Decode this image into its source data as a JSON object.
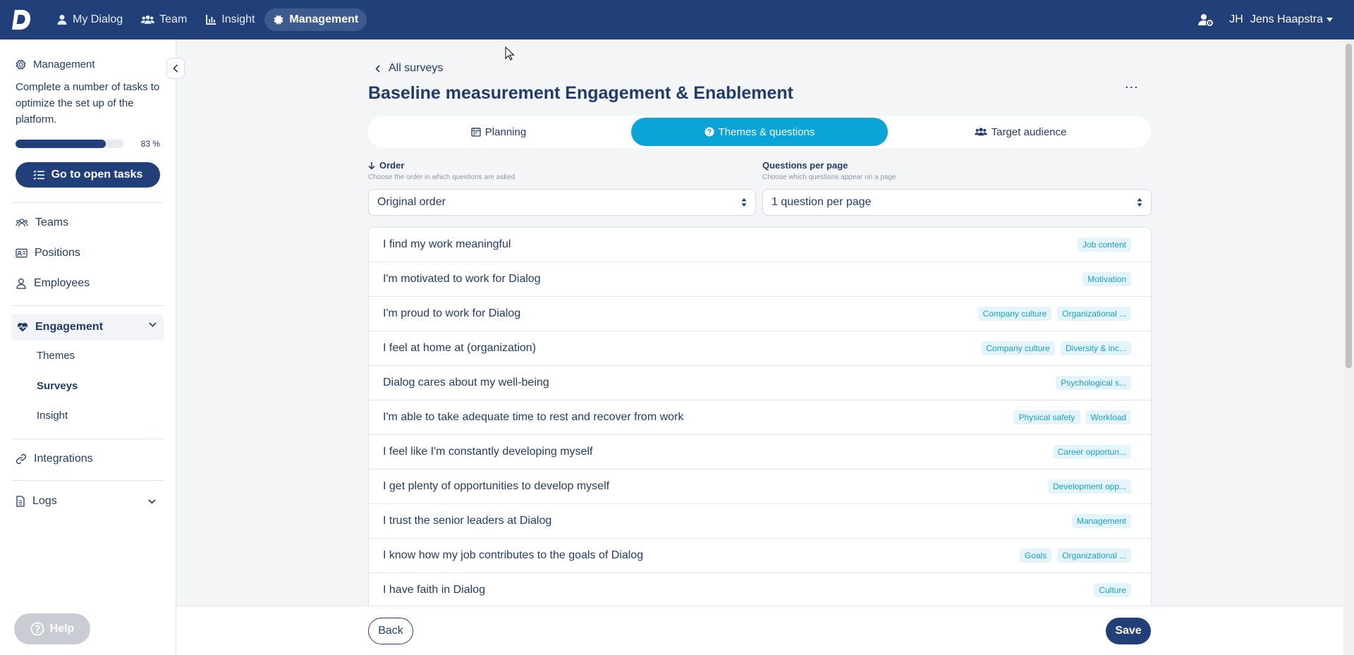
{
  "topnav": {
    "items": [
      {
        "label": "My Dialog",
        "icon": "user-icon"
      },
      {
        "label": "Team",
        "icon": "users-icon"
      },
      {
        "label": "Insight",
        "icon": "chart-icon"
      },
      {
        "label": "Management",
        "icon": "gear-icon",
        "active": true
      }
    ],
    "user_initials": "JH",
    "user_name": "Jens Haapstra"
  },
  "sidebar": {
    "management_title": "Management",
    "management_desc": "Complete a number of tasks to optimize the set up of the platform.",
    "progress_percent": 83,
    "progress_label": "83 %",
    "open_tasks_label": "Go to open tasks",
    "items": {
      "teams": "Teams",
      "positions": "Positions",
      "employees": "Employees",
      "engagement": "Engagement",
      "themes": "Themes",
      "surveys": "Surveys",
      "insight": "Insight",
      "integrations": "Integrations",
      "logs": "Logs"
    },
    "help_label": "Help"
  },
  "main": {
    "back_label": "All surveys",
    "title": "Baseline measurement Engagement & Enablement",
    "more_label": "...",
    "tabs": [
      {
        "label": "Planning",
        "active": false
      },
      {
        "label": "Themes & questions",
        "active": true
      },
      {
        "label": "Target audience",
        "active": false
      }
    ],
    "order": {
      "label": "Order",
      "hint": "Choose the order in which questions are asked",
      "value": "Original order"
    },
    "per_page": {
      "label": "Questions per page",
      "hint": "Choose which questions appear on a page",
      "value": "1 question per page"
    },
    "questions": [
      {
        "text": "I find my work meaningful",
        "tags": [
          "Job content"
        ]
      },
      {
        "text": "I'm motivated to work for Dialog",
        "tags": [
          "Motivation"
        ]
      },
      {
        "text": "I'm proud to work for Dialog",
        "tags": [
          "Company culture",
          "Organizational ..."
        ]
      },
      {
        "text": "I feel at home at (organization)",
        "tags": [
          "Company culture",
          "Diversity & inc..."
        ]
      },
      {
        "text": "Dialog cares about my well-being",
        "tags": [
          "Psychological s..."
        ]
      },
      {
        "text": "I'm able to take adequate time to rest and recover from work",
        "tags": [
          "Physical safety",
          "Workload"
        ]
      },
      {
        "text": "I feel like I'm constantly developing myself",
        "tags": [
          "Career opportun..."
        ]
      },
      {
        "text": "I get plenty of opportunities to develop myself",
        "tags": [
          "Development opp..."
        ]
      },
      {
        "text": "I trust the senior leaders at Dialog",
        "tags": [
          "Management"
        ]
      },
      {
        "text": "I know how my job contributes to the goals of Dialog",
        "tags": [
          "Goals",
          "Organizational ..."
        ]
      },
      {
        "text": "I have faith in Dialog",
        "tags": [
          "Culture"
        ]
      }
    ],
    "back_button": "Back",
    "save_button": "Save"
  },
  "colors": {
    "brand": "#213f78",
    "accent": "#0aa5d6",
    "tag_bg": "#e3f4fb",
    "tag_text": "#1b9ecf"
  }
}
